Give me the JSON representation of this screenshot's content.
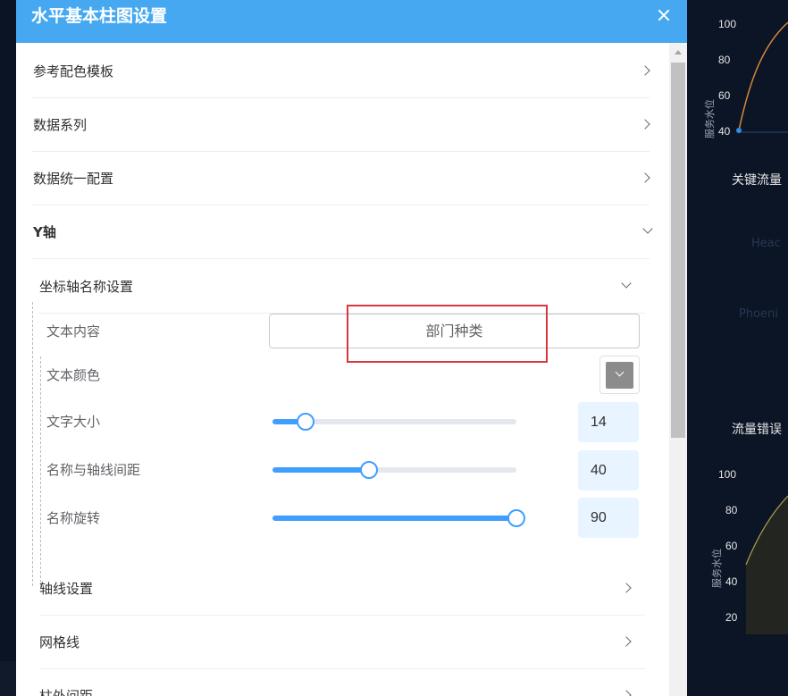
{
  "dialog": {
    "title": "水平基本柱图设置"
  },
  "sections": {
    "palette": "参考配色模板",
    "series": "数据系列",
    "unified": "数据统一配置",
    "y_axis": "Y轴"
  },
  "axis_name": {
    "title": "坐标轴名称设置",
    "text_content_label": "文本内容",
    "text_content_value": "部门种类",
    "text_color_label": "文本颜色",
    "text_color_value": "#8c8c8c",
    "font_size_label": "文字大小",
    "font_size_value": "14",
    "font_size_fraction": 0.137,
    "gap_label": "名称与轴线间距",
    "gap_value": "40",
    "gap_fraction": 0.396,
    "rotate_label": "名称旋转",
    "rotate_value": "90",
    "rotate_fraction": 1.0
  },
  "subsections": {
    "axis_line": "轴线设置",
    "grid_line": "网格线",
    "bar_gap": "柱外间距"
  },
  "background": {
    "top_chart_ticks": [
      "100",
      "80",
      "60",
      "40"
    ],
    "top_axis_name": "服务水位",
    "panel_title_1": "关键流量",
    "panel_title_2": "流量错误",
    "bottom_chart_ticks": [
      "100",
      "80",
      "60",
      "40",
      "20"
    ],
    "bottom_axis_name": "服务水位"
  },
  "colors": {
    "header": "#45a8f0",
    "accent": "#409eff",
    "highlight": "#d9363e"
  }
}
